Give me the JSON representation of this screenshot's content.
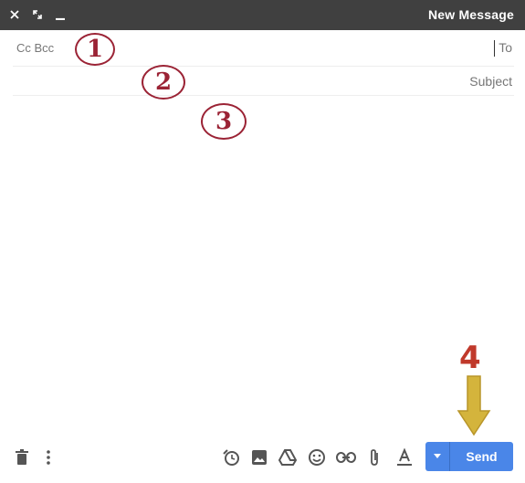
{
  "window": {
    "title": "New Message"
  },
  "header_controls": {
    "close": "close-icon",
    "expand": "expand-icon",
    "minimize": "minimize-icon"
  },
  "recipients": {
    "to_label": "To",
    "cc_bcc_label": "Cc Bcc",
    "to_value": ""
  },
  "subject": {
    "placeholder": "Subject",
    "value": ""
  },
  "body": {
    "value": ""
  },
  "annotations": {
    "m1": "1",
    "m2": "2",
    "m3": "3",
    "m4": "4",
    "marker_color": "#9b2335",
    "arrow_color": "#d4b43c"
  },
  "toolbar": {
    "send_label": "Send",
    "accent": "#4a86e8",
    "icons": [
      "discard-icon",
      "more-options-icon",
      "schedule-icon",
      "insert-photo-icon",
      "drive-icon",
      "emoji-icon",
      "link-icon",
      "attach-icon",
      "format-text-icon"
    ]
  }
}
